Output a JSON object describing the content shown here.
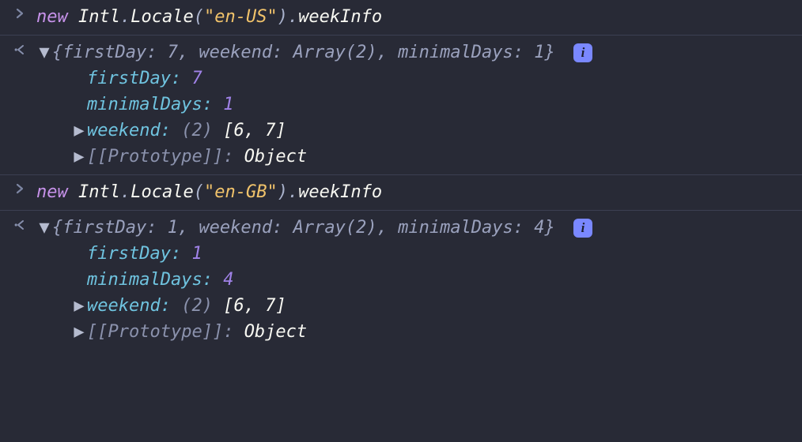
{
  "glyphs": {
    "triangle_down": "▼",
    "triangle_right": "▶",
    "info": "i"
  },
  "entries": [
    {
      "input": {
        "kw": "new",
        "class": "Intl",
        "ctor": "Locale",
        "arg": "\"en-US\"",
        "prop": "weekInfo"
      },
      "summary": "{firstDay: 7, weekend: Array(2), minimalDays: 1}",
      "props": {
        "firstDay": "7",
        "minimalDays": "1",
        "weekend_len": "(2)",
        "weekend_vals": "[6, 7]",
        "proto_label": "[[Prototype]]",
        "proto_val": "Object"
      }
    },
    {
      "input": {
        "kw": "new",
        "class": "Intl",
        "ctor": "Locale",
        "arg": "\"en-GB\"",
        "prop": "weekInfo"
      },
      "summary": "{firstDay: 1, weekend: Array(2), minimalDays: 4}",
      "props": {
        "firstDay": "1",
        "minimalDays": "4",
        "weekend_len": "(2)",
        "weekend_vals": "[6, 7]",
        "proto_label": "[[Prototype]]",
        "proto_val": "Object"
      }
    }
  ],
  "chart_data": {
    "type": "table",
    "title": "Intl.Locale weekInfo comparison",
    "columns": [
      "locale",
      "firstDay",
      "minimalDays",
      "weekend"
    ],
    "rows": [
      {
        "locale": "en-US",
        "firstDay": 7,
        "minimalDays": 1,
        "weekend": [
          6,
          7
        ]
      },
      {
        "locale": "en-GB",
        "firstDay": 1,
        "minimalDays": 4,
        "weekend": [
          6,
          7
        ]
      }
    ]
  }
}
